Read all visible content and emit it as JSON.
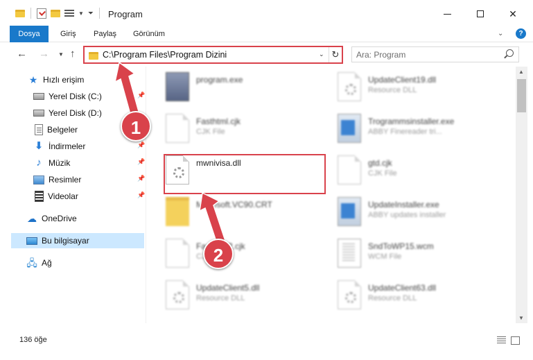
{
  "window": {
    "title": "Program",
    "controls": {
      "minimize": "minimize",
      "maximize": "maximize",
      "close": "✕"
    }
  },
  "ribbon": {
    "tabs": [
      "Dosya",
      "Giriş",
      "Paylaş",
      "Görünüm"
    ],
    "help": "?"
  },
  "address": {
    "path": "C:\\Program Files\\Program Dizini",
    "search_placeholder": "Ara: Program"
  },
  "nav_pane": {
    "items": [
      {
        "label": "Hızlı erişim",
        "icon": "star-icon"
      },
      {
        "label": "Yerel Disk (C:)",
        "icon": "drive-icon",
        "pinned": true
      },
      {
        "label": "Yerel Disk (D:)",
        "icon": "drive-icon"
      },
      {
        "label": "Belgeler",
        "icon": "documents-icon"
      },
      {
        "label": "İndirmeler",
        "icon": "download-icon",
        "pinned": true
      },
      {
        "label": "Müzik",
        "icon": "music-icon",
        "pinned": true
      },
      {
        "label": "Resimler",
        "icon": "pictures-icon",
        "pinned": true
      },
      {
        "label": "Videolar",
        "icon": "videos-icon",
        "pinned": true
      },
      {
        "label": "OneDrive",
        "icon": "cloud-icon"
      },
      {
        "label": "Bu bilgisayar",
        "icon": "computer-icon",
        "selected": true
      },
      {
        "label": "Ağ",
        "icon": "network-icon"
      }
    ]
  },
  "files": [
    {
      "name": "program.exe",
      "type": "",
      "icon": "exe-icon",
      "blurred": true
    },
    {
      "name": "UpdateClient19.dll",
      "type": "Resource DLL",
      "icon": "gear-file-icon",
      "blurred": true
    },
    {
      "name": "Fasthtml.cjk",
      "type": "CJK File",
      "icon": "blank-file-icon",
      "blurred": true
    },
    {
      "name": "Trogrammsinstaller.exe",
      "type": "ABBY Finereader tri...",
      "icon": "installer-icon",
      "blurred": true
    },
    {
      "name": "mwnivisa.dll",
      "type": "",
      "icon": "gear-file-icon",
      "blurred": false
    },
    {
      "name": "gtd.cjk",
      "type": "CJK File",
      "icon": "blank-file-icon",
      "blurred": true
    },
    {
      "name": "Microsoft.VC90.CRT",
      "type": "",
      "icon": "folder-icon",
      "blurred": true
    },
    {
      "name": "UpdateInstaller.exe",
      "type": "ABBY updates installer",
      "icon": "installer-icon",
      "blurred": true
    },
    {
      "name": "Fasthtml2.cjk",
      "type": "CJK File",
      "icon": "blank-file-icon",
      "blurred": true
    },
    {
      "name": "SndToWP15.wcm",
      "type": "WCM File",
      "icon": "wcm-file-icon",
      "blurred": true
    },
    {
      "name": "UpdateClient5.dll",
      "type": "Resource DLL",
      "icon": "gear-file-icon",
      "blurred": true
    },
    {
      "name": "UpdateClient63.dll",
      "type": "Resource DLL",
      "icon": "gear-file-icon",
      "blurred": true
    }
  ],
  "annotations": {
    "step1": "1",
    "step2": "2",
    "accent": "#d9424b"
  },
  "status": {
    "item_count": "136 öğe"
  },
  "colors": {
    "ribbon_file_tab": "#1979ca",
    "selection": "#cce8ff",
    "highlight": "#d9424b"
  }
}
